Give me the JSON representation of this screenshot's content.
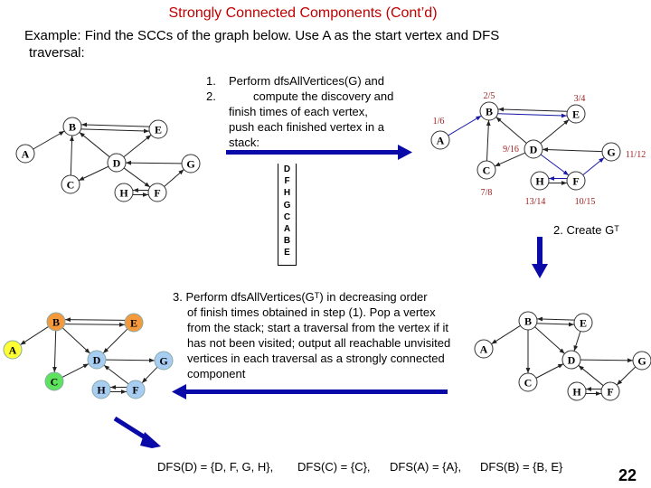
{
  "title": "Strongly Connected Components (Cont’d)",
  "intro": [
    "Example: Find the SCCs of the graph below. Use A as the start vertex and DFS",
    "traversal:"
  ],
  "steps": {
    "step1_num": "1.",
    "step1": "Perform dfsAllVertices(G) and",
    "step2_num": "2.",
    "step2_lines": [
      "compute the discovery and",
      "finish times of each vertex,",
      "push each finished vertex in a",
      "stack:"
    ],
    "create_transpose": "2. Create Gᵀ",
    "step3_lines": [
      "3. Perform dfsAllVertices(Gᵀ) in decreasing order",
      "of finish times obtained in step (1). Pop a vertex",
      "from the stack; start a traversal from the vertex if it",
      "has not been visited; output all reachable unvisited",
      "vertices in each traversal as a strongly connected",
      "component"
    ]
  },
  "stack": [
    "D",
    "F",
    "H",
    "G",
    "C",
    "A",
    "B",
    "E"
  ],
  "graph_g": {
    "nodes": [
      "A",
      "B",
      "C",
      "D",
      "E",
      "F",
      "G",
      "H"
    ],
    "edges": [
      [
        "A",
        "B"
      ],
      [
        "B",
        "E"
      ],
      [
        "E",
        "B"
      ],
      [
        "D",
        "B"
      ],
      [
        "D",
        "E"
      ],
      [
        "C",
        "B"
      ],
      [
        "D",
        "C"
      ],
      [
        "D",
        "F"
      ],
      [
        "F",
        "H"
      ],
      [
        "H",
        "F"
      ],
      [
        "G",
        "D"
      ],
      [
        "F",
        "G"
      ]
    ]
  },
  "graph_dfs": {
    "times": {
      "A": "1/6",
      "B": "2/5",
      "E": "3/4",
      "D": "9/16",
      "G": "11/12",
      "C": "7/8",
      "H": "13/14",
      "F": "10/15"
    },
    "tree_edges": [
      [
        "A",
        "B"
      ],
      [
        "B",
        "E"
      ],
      [
        "D",
        "F"
      ],
      [
        "F",
        "H"
      ],
      [
        "F",
        "G"
      ]
    ]
  },
  "graph_transpose": {
    "edges": [
      [
        "B",
        "A"
      ],
      [
        "E",
        "B"
      ],
      [
        "B",
        "E"
      ],
      [
        "B",
        "D"
      ],
      [
        "E",
        "D"
      ],
      [
        "B",
        "C"
      ],
      [
        "C",
        "D"
      ],
      [
        "F",
        "D"
      ],
      [
        "H",
        "F"
      ],
      [
        "F",
        "H"
      ],
      [
        "D",
        "G"
      ],
      [
        "G",
        "F"
      ]
    ]
  },
  "scc_colors": {
    "A": "#ffff33",
    "B": "#f59a3c",
    "E": "#f59a3c",
    "C": "#5ee35e",
    "D": "#a8cdf2",
    "G": "#a8cdf2",
    "H": "#a8cdf2",
    "F": "#a8cdf2"
  },
  "colors": {
    "title": "#c00000",
    "arrow": "#0a0aa8",
    "time_label": "#a02020",
    "tree_edge": "#1a1aa8"
  },
  "result": [
    "DFS(D) = {D, F, G, H},",
    "DFS(C) = {C},",
    "DFS(A) = {A},",
    "DFS(B) = {B, E}"
  ],
  "page_number": "22"
}
